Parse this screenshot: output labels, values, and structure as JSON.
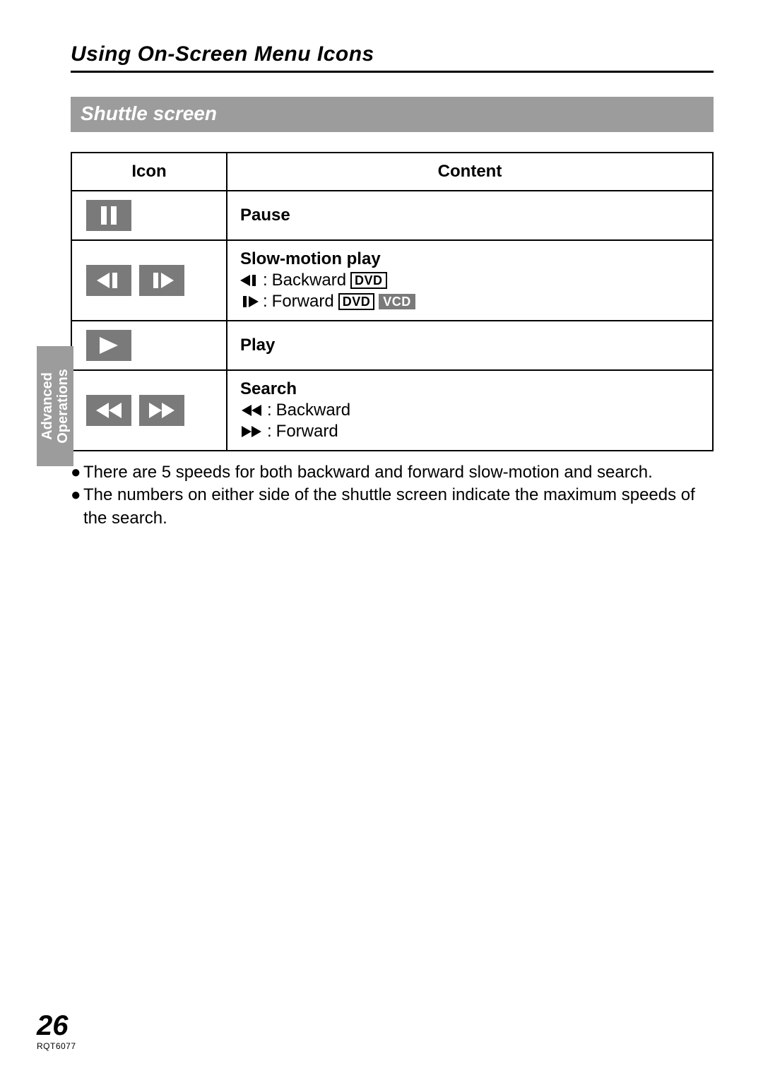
{
  "heading": "Using On-Screen Menu Icons",
  "section_title": "Shuttle screen",
  "side_tab": {
    "line1": "Advanced",
    "line2": "Operations"
  },
  "table": {
    "headers": {
      "icon": "Icon",
      "content": "Content"
    },
    "rows": [
      {
        "icon_name": "pause",
        "title": "Pause"
      },
      {
        "icon_name": "slow",
        "title": "Slow-motion play",
        "lines": [
          {
            "symbol": "slow-back",
            "text": "Backward",
            "badges": [
              "DVD"
            ]
          },
          {
            "symbol": "slow-fwd",
            "text": "Forward",
            "badges": [
              "DVD",
              "VCD"
            ]
          }
        ]
      },
      {
        "icon_name": "play",
        "title": "Play"
      },
      {
        "icon_name": "search",
        "title": "Search",
        "lines": [
          {
            "symbol": "rewind",
            "text": "Backward"
          },
          {
            "symbol": "ffwd",
            "text": "Forward"
          }
        ]
      }
    ]
  },
  "badges": {
    "DVD": "DVD",
    "VCD": "VCD"
  },
  "bullets": [
    "There are 5 speeds for both backward and forward slow-motion and search.",
    "The numbers on either side of the shuttle screen indicate the maximum speeds of the search."
  ],
  "page_number": "26",
  "doc_code": "RQT6077"
}
